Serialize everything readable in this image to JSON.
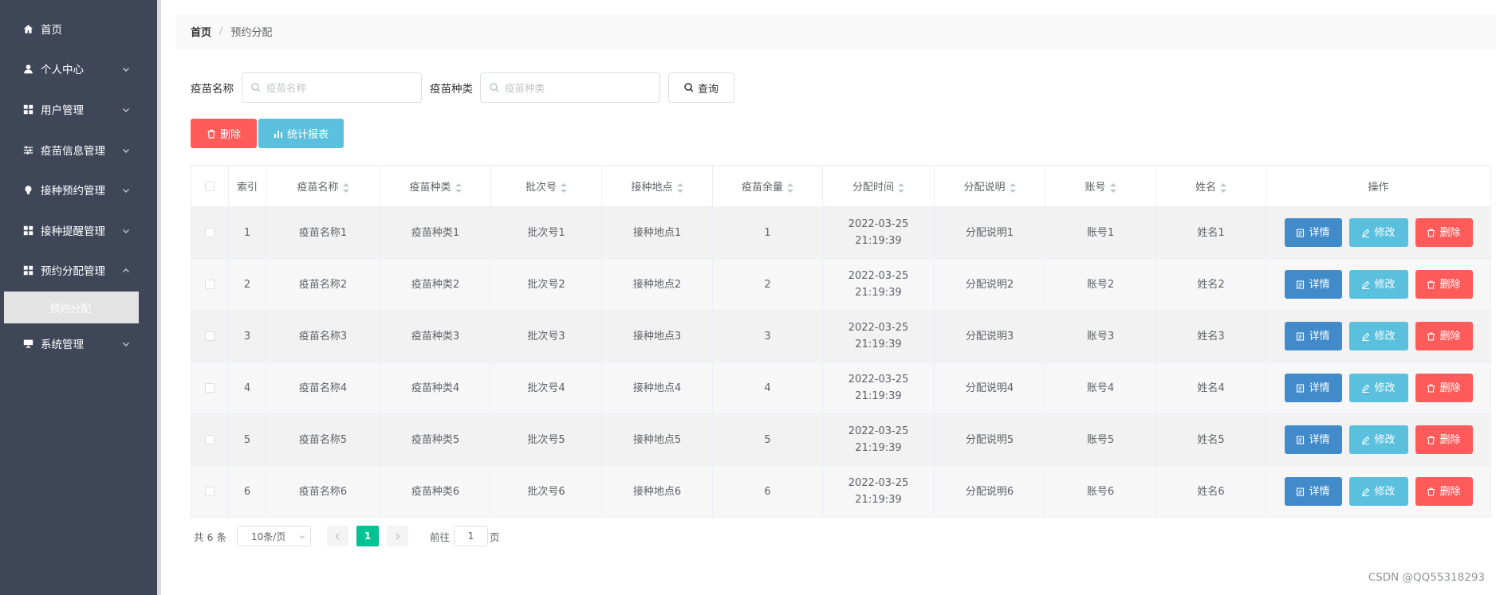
{
  "sidebar": {
    "items": [
      {
        "label": "首页",
        "icon": "home-icon",
        "expandable": false
      },
      {
        "label": "个人中心",
        "icon": "user-icon",
        "expandable": true
      },
      {
        "label": "用户管理",
        "icon": "grid-icon",
        "expandable": true
      },
      {
        "label": "疫苗信息管理",
        "icon": "sliders-icon",
        "expandable": true
      },
      {
        "label": "接种预约管理",
        "icon": "bulb-icon",
        "expandable": true
      },
      {
        "label": "接种提醒管理",
        "icon": "grid-icon",
        "expandable": true
      },
      {
        "label": "预约分配管理",
        "icon": "grid-icon",
        "expandable": true
      },
      {
        "label": "系统管理",
        "icon": "monitor-icon",
        "expandable": true
      }
    ],
    "active_sub": "预约分配"
  },
  "breadcrumb": {
    "home": "首页",
    "separator": "/",
    "current": "预约分配"
  },
  "search": {
    "name_label": "疫苗名称",
    "name_placeholder": "疫苗名称",
    "type_label": "疫苗种类",
    "type_placeholder": "疫苗种类",
    "query_label": "查询"
  },
  "actions": {
    "delete_label": "删除",
    "report_label": "统计报表"
  },
  "table": {
    "headers": {
      "index": "索引",
      "name": "疫苗名称",
      "type": "疫苗种类",
      "batch": "批次号",
      "site": "接种地点",
      "remain": "疫苗余量",
      "time": "分配时间",
      "desc": "分配说明",
      "account": "账号",
      "person": "姓名",
      "ops": "操作"
    },
    "rows": [
      {
        "index": "1",
        "name": "疫苗名称1",
        "type": "疫苗种类1",
        "batch": "批次号1",
        "site": "接种地点1",
        "remain": "1",
        "time": "2022-03-25 21:19:39",
        "desc": "分配说明1",
        "account": "账号1",
        "person": "姓名1"
      },
      {
        "index": "2",
        "name": "疫苗名称2",
        "type": "疫苗种类2",
        "batch": "批次号2",
        "site": "接种地点2",
        "remain": "2",
        "time": "2022-03-25 21:19:39",
        "desc": "分配说明2",
        "account": "账号2",
        "person": "姓名2"
      },
      {
        "index": "3",
        "name": "疫苗名称3",
        "type": "疫苗种类3",
        "batch": "批次号3",
        "site": "接种地点3",
        "remain": "3",
        "time": "2022-03-25 21:19:39",
        "desc": "分配说明3",
        "account": "账号3",
        "person": "姓名3"
      },
      {
        "index": "4",
        "name": "疫苗名称4",
        "type": "疫苗种类4",
        "batch": "批次号4",
        "site": "接种地点4",
        "remain": "4",
        "time": "2022-03-25 21:19:39",
        "desc": "分配说明4",
        "account": "账号4",
        "person": "姓名4"
      },
      {
        "index": "5",
        "name": "疫苗名称5",
        "type": "疫苗种类5",
        "batch": "批次号5",
        "site": "接种地点5",
        "remain": "5",
        "time": "2022-03-25 21:19:39",
        "desc": "分配说明5",
        "account": "账号5",
        "person": "姓名5"
      },
      {
        "index": "6",
        "name": "疫苗名称6",
        "type": "疫苗种类6",
        "batch": "批次号6",
        "site": "接种地点6",
        "remain": "6",
        "time": "2022-03-25 21:19:39",
        "desc": "分配说明6",
        "account": "账号6",
        "person": "姓名6"
      }
    ],
    "row_buttons": {
      "detail": "详情",
      "edit": "修改",
      "delete": "删除"
    }
  },
  "pagination": {
    "total": "共 6 条",
    "page_size": "10条/页",
    "current_page": "1",
    "goto_label": "前往",
    "goto_value": "1",
    "page_suffix": "页"
  },
  "watermark": "CSDN @QQ55318293",
  "colors": {
    "sidebar_bg": "#3f4658",
    "danger": "#ff5b5b",
    "info": "#5bc0de",
    "primary": "#428bca",
    "pagination_active": "#00c292"
  }
}
